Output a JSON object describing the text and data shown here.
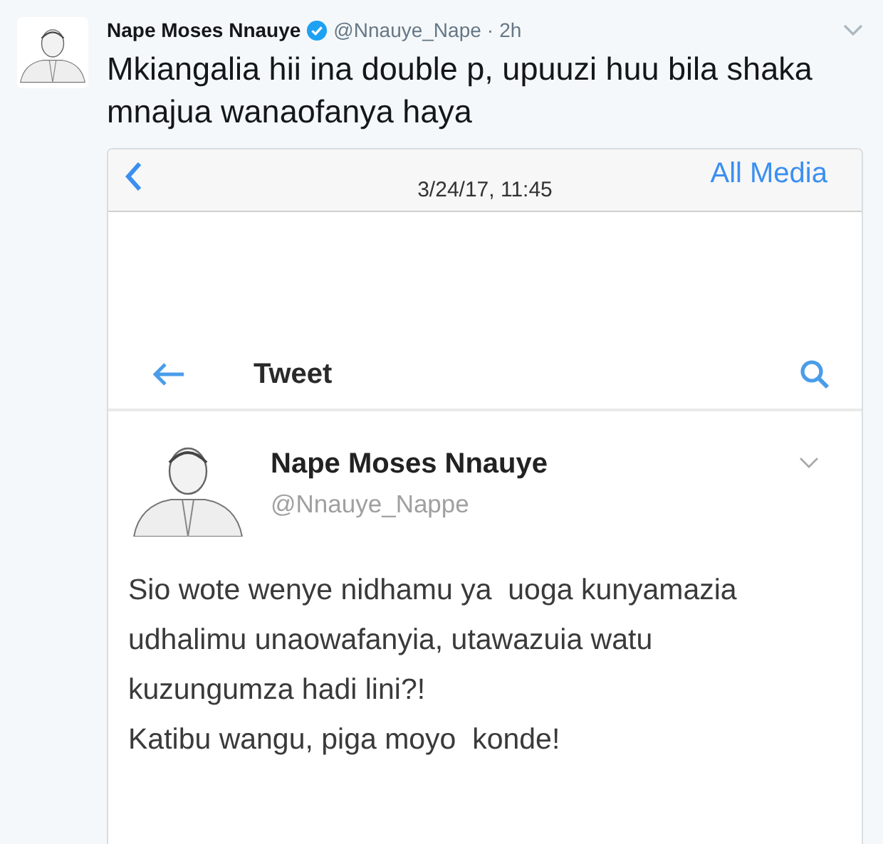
{
  "tweet": {
    "name": "Nape Moses Nnauye",
    "verified": true,
    "handle": "@Nnauye_Nape",
    "separator": "·",
    "time": "2h",
    "text": "Mkiangalia hii ina double p, upuuzi huu bila shaka mnajua wanaofanya haya"
  },
  "screenshot": {
    "header": {
      "date": "3/24/17, 11:45",
      "action": "All Media"
    },
    "nav": {
      "title": "Tweet"
    },
    "quoted": {
      "name": "Nape Moses Nnauye",
      "handle": "@Nnauye_Nappe",
      "paragraphs": [
        "Sio wote wenye nidhamu ya  uoga kunyamazia udhalimu unaowafanyia, utawazuia watu  kuzungumza hadi lini?!",
        "Katibu wangu, piga moyo  konde!"
      ]
    }
  }
}
